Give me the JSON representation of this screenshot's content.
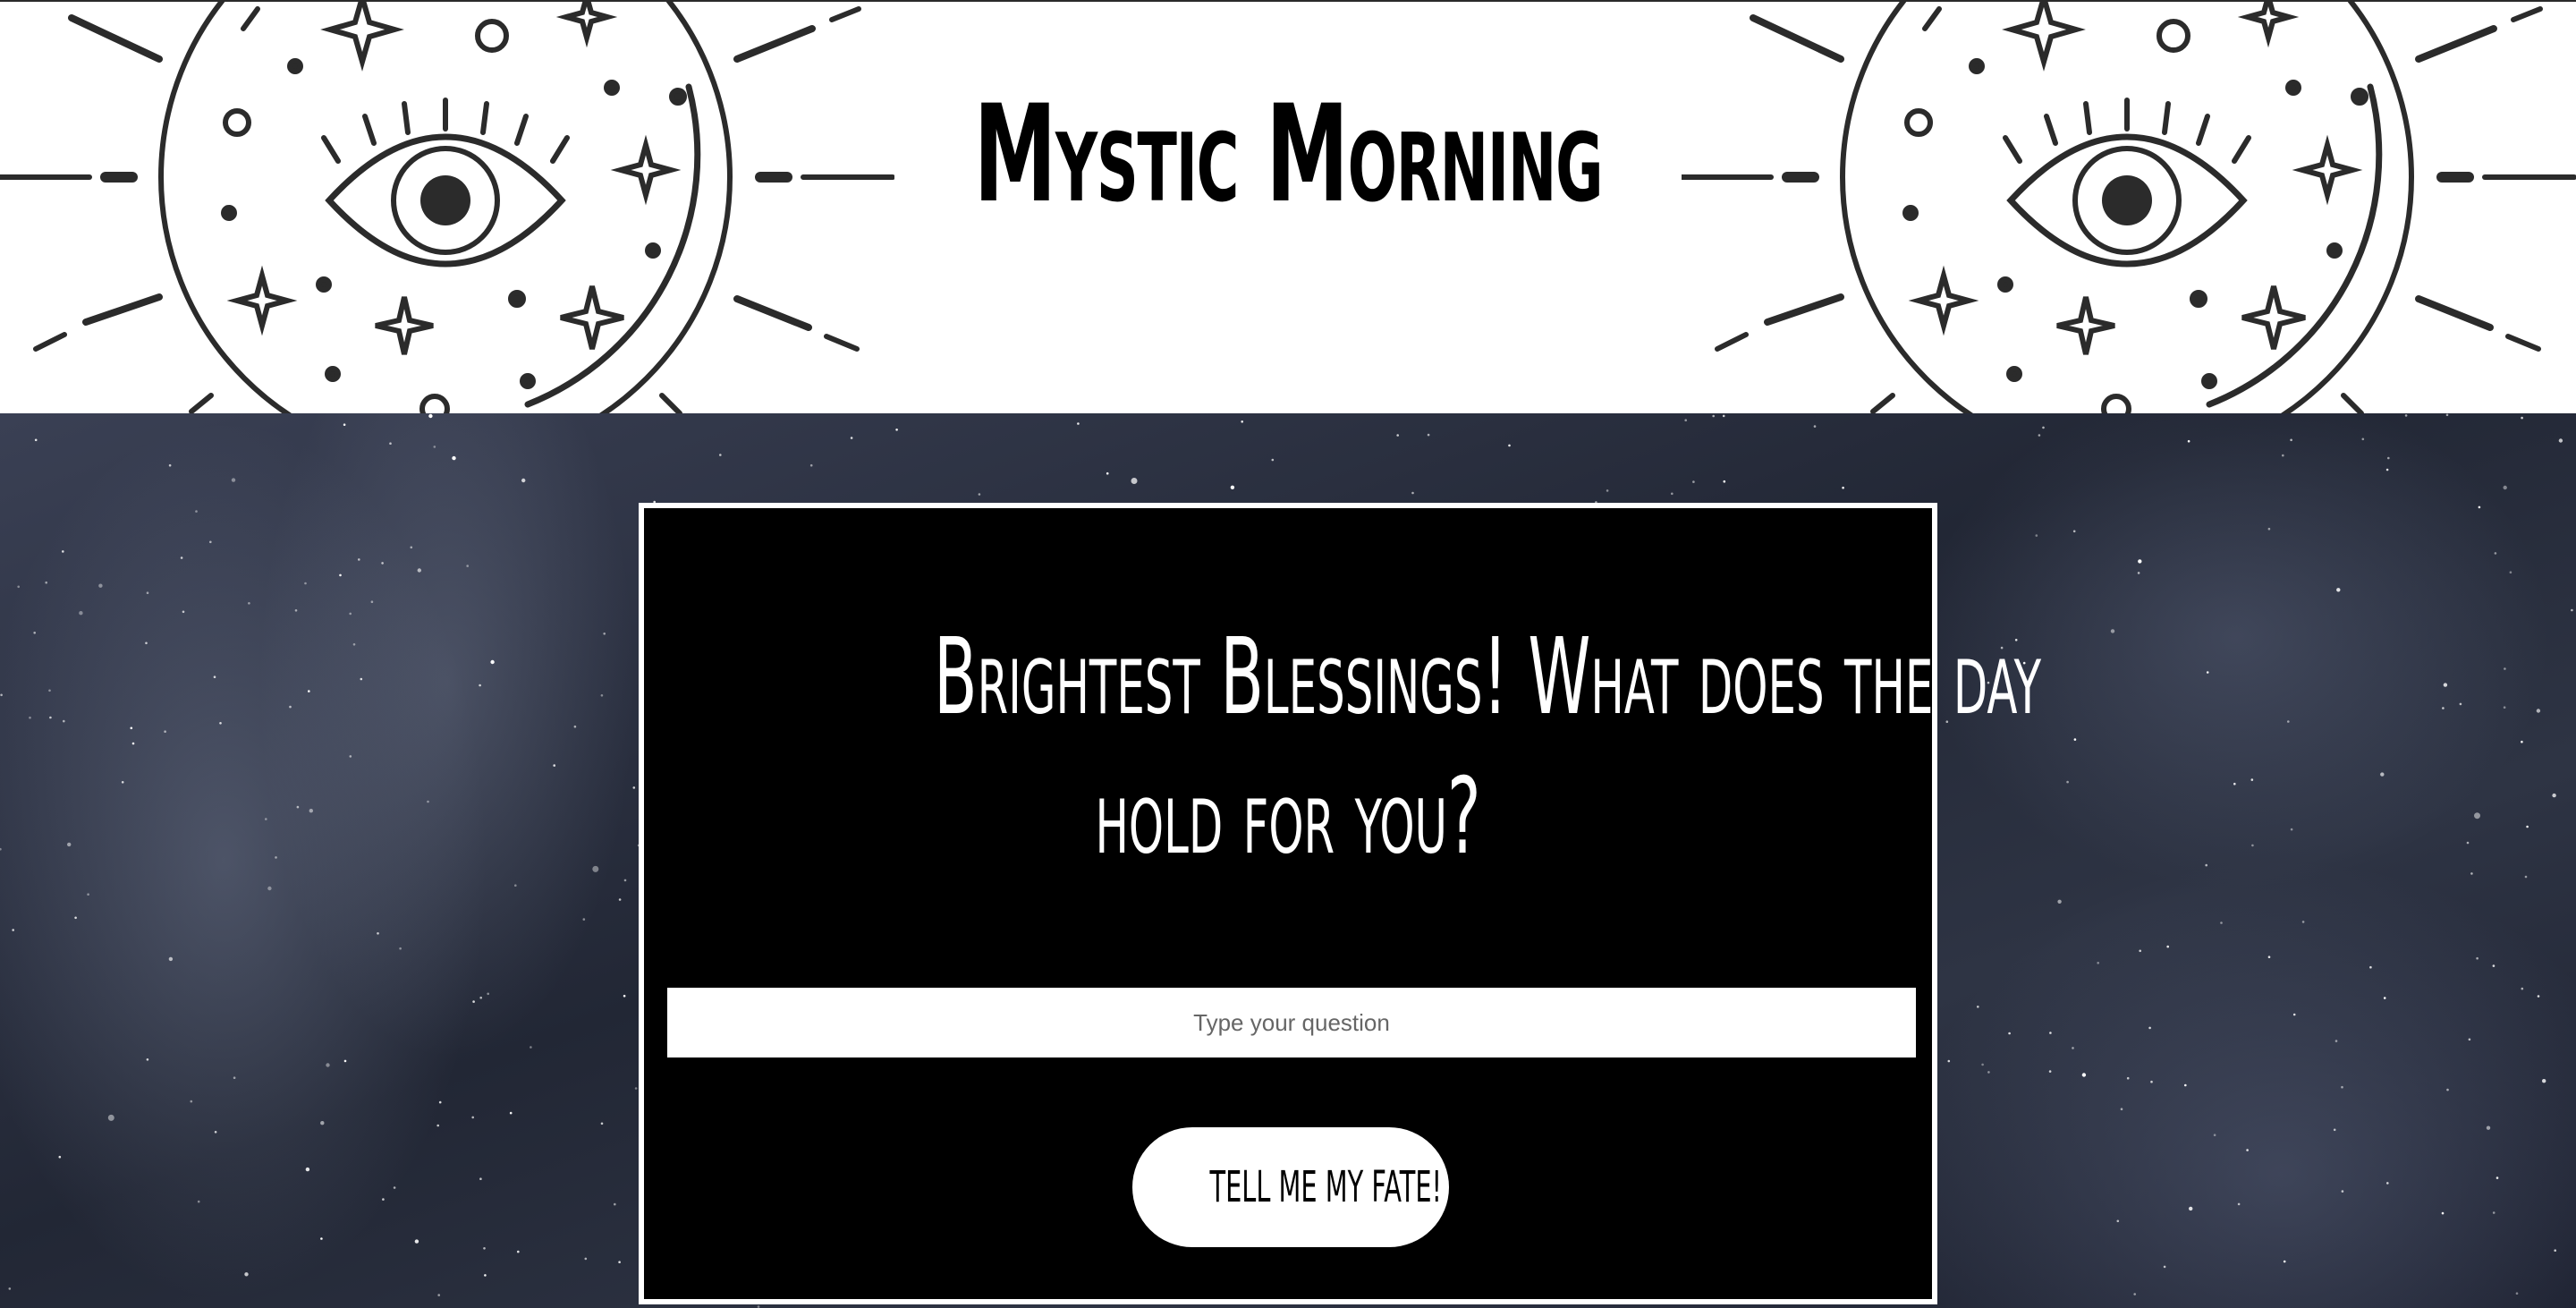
{
  "header": {
    "title": "Mystic Morning",
    "emblem_icon": "all-seeing-eye-icon"
  },
  "card": {
    "heading_line1": "Brightest Blessings! What does the day",
    "heading_line2": "hold for you?",
    "input_placeholder": "Type your question",
    "input_value": "",
    "button_label": "TELL ME MY FATE!"
  },
  "colors": {
    "header_bg": "#ffffff",
    "card_bg": "#000000",
    "accent": "#ffffff",
    "background": "#2a2f3c"
  }
}
